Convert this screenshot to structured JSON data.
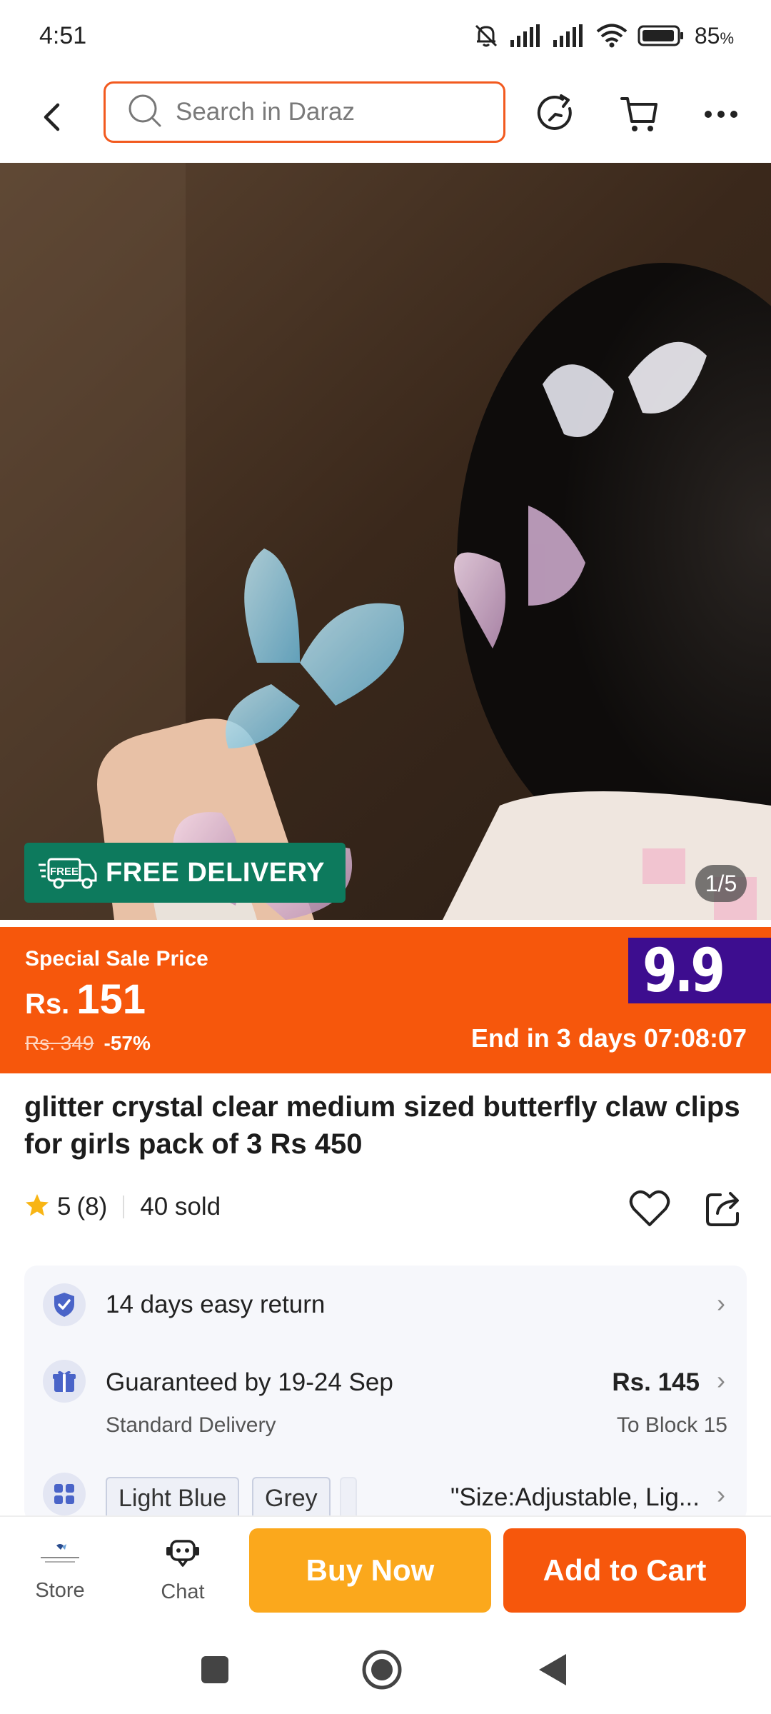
{
  "status_bar": {
    "time": "4:51",
    "battery": "85",
    "battery_unit": "%",
    "icons": [
      "bell-off-icon",
      "signal-icon",
      "signal-icon",
      "wifi-icon",
      "battery-icon"
    ]
  },
  "top_nav": {
    "search_placeholder": "Search in Daraz",
    "icons": [
      "back-icon",
      "search-icon",
      "share-refresh-icon",
      "cart-icon",
      "more-icon"
    ],
    "accent": "#f25a1f"
  },
  "gallery": {
    "free_delivery_label": "FREE DELIVERY",
    "free_badge_text": "FREE",
    "counter": "1/5",
    "badge_color": "#0d7a5d"
  },
  "price": {
    "sale_label": "Special Sale Price",
    "currency": "Rs.",
    "current": "151",
    "original": "Rs. 349",
    "discount": "-57%",
    "promo": "9.9",
    "countdown": "End in 3 days 07:08:07",
    "banner_color": "#f6570c",
    "promo_color": "#3d0d8f"
  },
  "product": {
    "title": "glitter crystal clear medium sized butterfly claw clips for girls pack of 3 Rs 450",
    "rating": "5",
    "rating_count": "(8)",
    "sold": "40 sold",
    "star_color": "#f8b514"
  },
  "info": {
    "return_label": "14 days easy return",
    "delivery_label": "Guaranteed by 19-24 Sep",
    "delivery_sub": "Standard Delivery",
    "delivery_price": "Rs. 145",
    "delivery_location": "To Block 15",
    "variants": [
      "Light Blue",
      "Grey"
    ],
    "variant_summary": "\"Size:Adjustable, Lig..."
  },
  "bottom_bar": {
    "store_label": "Store",
    "chat_label": "Chat",
    "buy_now": "Buy Now",
    "add_to_cart": "Add to Cart",
    "buy_color": "#fba81c",
    "cart_color": "#f6570c"
  },
  "system_nav": {
    "icons": [
      "recent-apps-icon",
      "home-icon",
      "back-nav-icon"
    ]
  }
}
